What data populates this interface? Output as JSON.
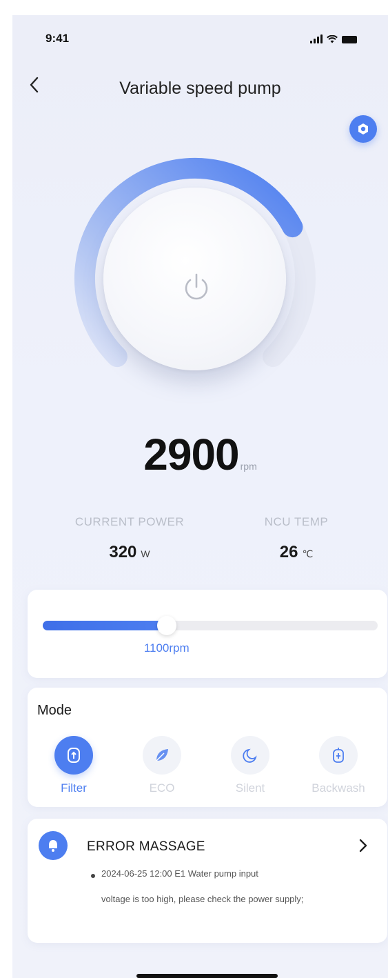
{
  "status": {
    "time": "9:41"
  },
  "header": {
    "title": "Variable speed pump"
  },
  "dial": {
    "speed": "2900",
    "unit": "rpm",
    "arc_fraction": 0.73
  },
  "stats": {
    "power": {
      "label": "CURRENT POWER",
      "value": "320",
      "unit": "W"
    },
    "temp": {
      "label": "NCU TEMP",
      "value": "26",
      "unit": "℃"
    }
  },
  "slider": {
    "label": "1100rpm",
    "fraction": 0.37
  },
  "mode": {
    "title": "Mode",
    "items": [
      {
        "label": "Filter",
        "icon": "filter-icon",
        "active": true
      },
      {
        "label": "ECO",
        "icon": "leaf-icon",
        "active": false
      },
      {
        "label": "Silent",
        "icon": "moon-icon",
        "active": false
      },
      {
        "label": "Backwash",
        "icon": "backwash-icon",
        "active": false
      }
    ]
  },
  "error": {
    "title": "ERROR MASSAGE",
    "line1": "2024-06-25  12:00  E1 Water pump input",
    "line2": "voltage is too high, please check the power supply;"
  },
  "colors": {
    "accent": "#4d7ef0",
    "muted": "#d0d3db"
  }
}
